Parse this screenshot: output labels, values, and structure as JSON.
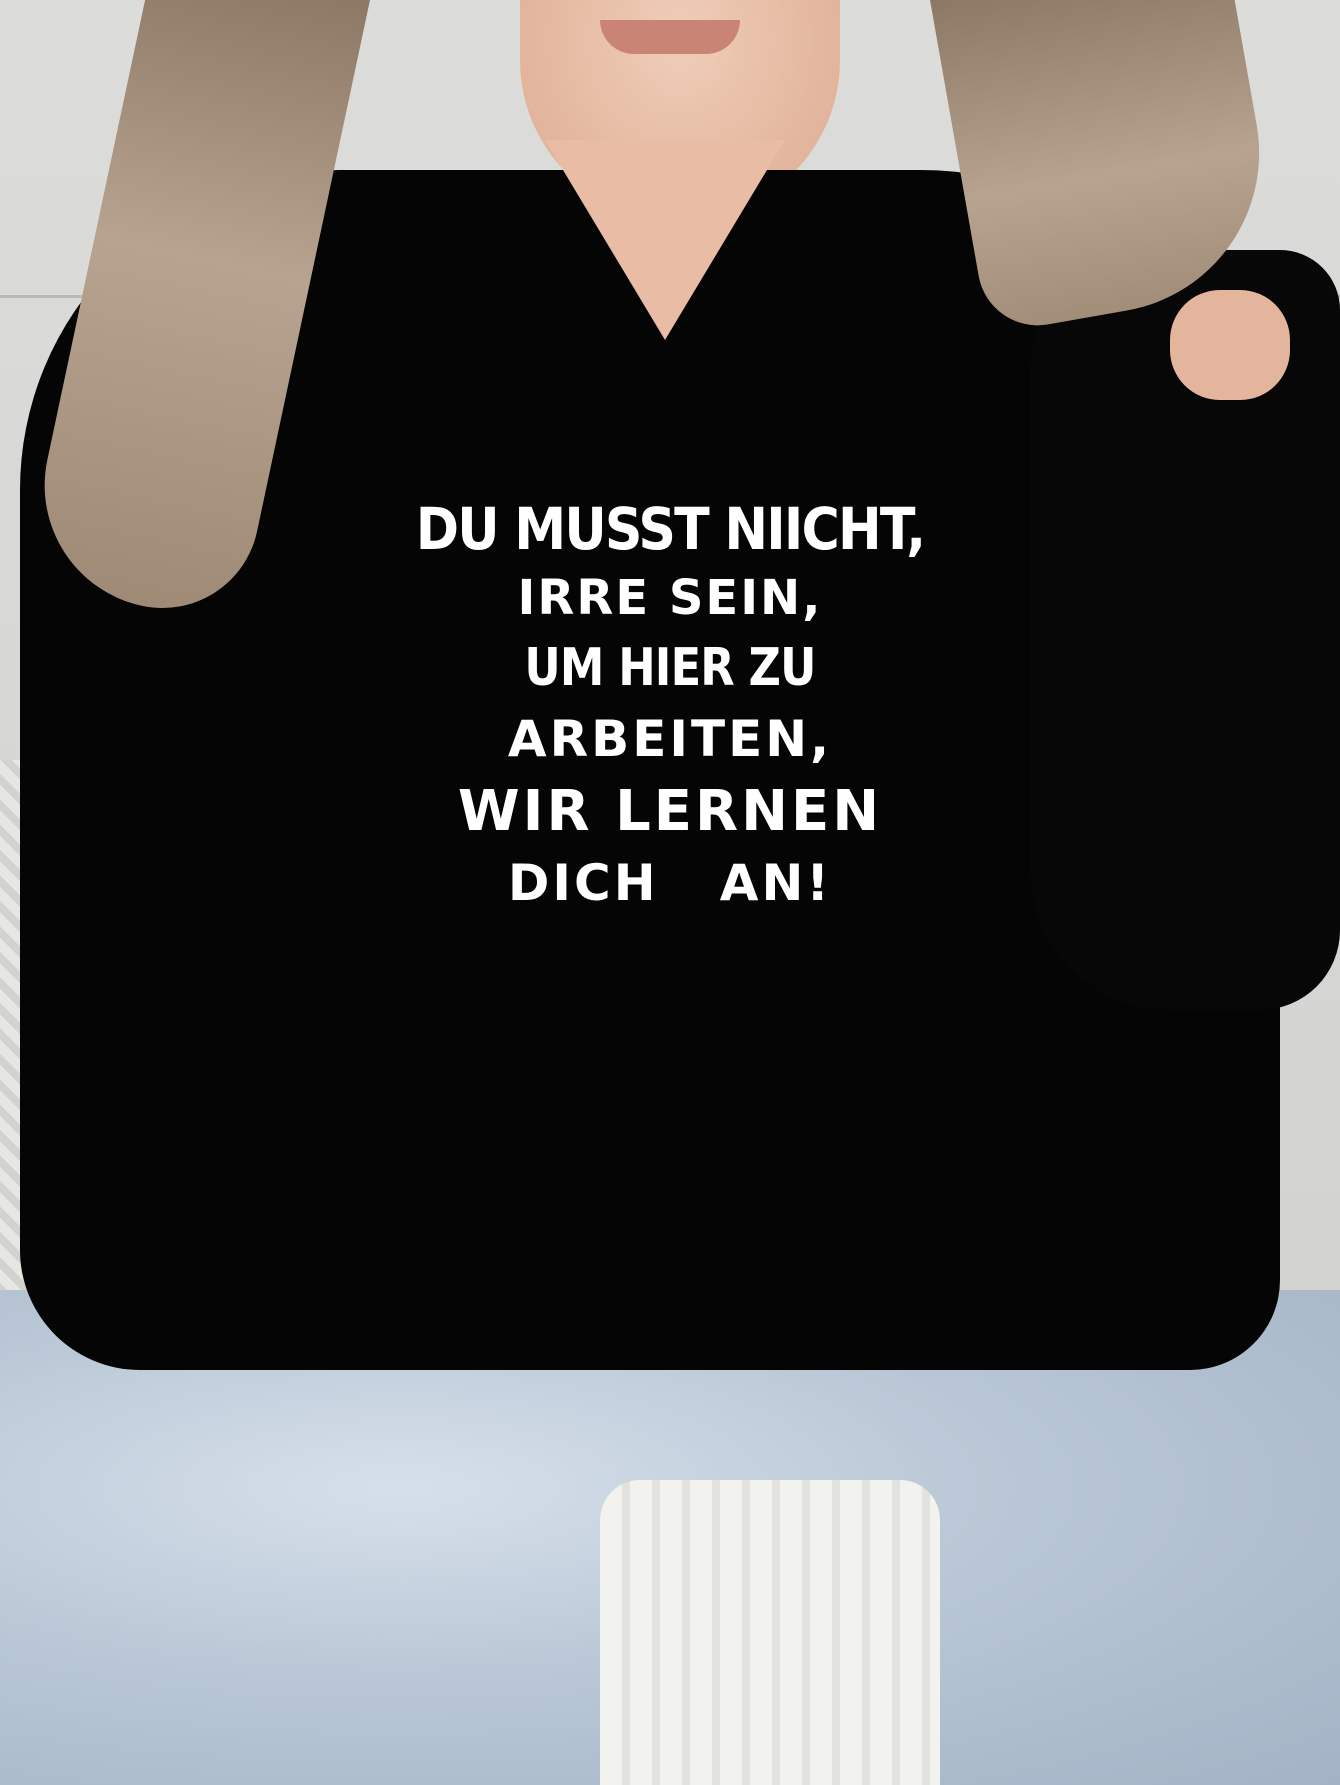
{
  "photo": {
    "subject": "person-wearing-black-hoodie",
    "colors": {
      "hoodie": "#050505",
      "print_text": "#ffffff",
      "background": "#d8d8d6",
      "jeans": "#b9c7d6"
    },
    "print_lines": [
      "DU MUSST NIICHT,",
      "IRRE SEIN,",
      "UM HIER ZU",
      "ARBEITEN,",
      "WIR LERNEN",
      "DICH   AN!"
    ]
  }
}
